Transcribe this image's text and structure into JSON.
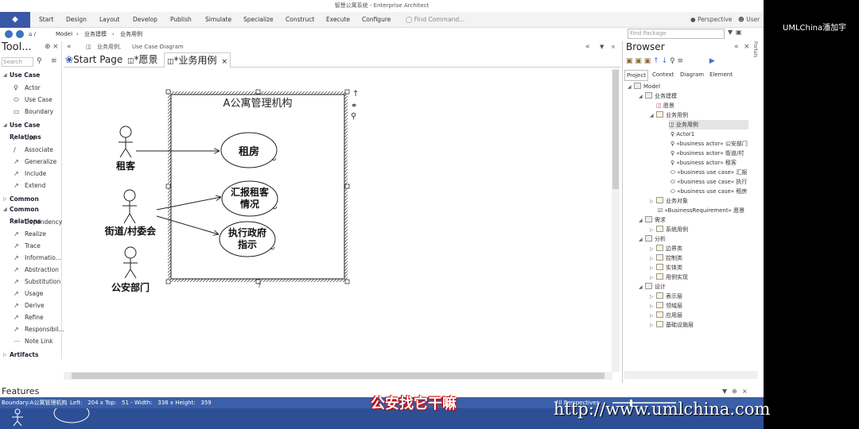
{
  "window": {
    "title": "智慧公寓系统 - Enterprise Architect"
  },
  "ribbon": {
    "menu": [
      "Start",
      "Design",
      "Layout",
      "Develop",
      "Publish",
      "Simulate",
      "Specialize",
      "Construct",
      "Execute",
      "Configure"
    ],
    "find_command": "Find Command...",
    "perspective": "Perspective",
    "user": "User"
  },
  "nav": {
    "path": [
      "Model",
      "业务建模",
      "业务用例"
    ]
  },
  "diagram_header": {
    "name": "业务用例,",
    "type": "Use Case Diagram"
  },
  "toolbox": {
    "title": "Tool...",
    "search_placeholder": "Search",
    "sections": [
      {
        "name": "Use Case",
        "items": [
          "Actor",
          "Use Case",
          "Boundary"
        ]
      },
      {
        "name": "Use Case Relations",
        "items": [
          "Use",
          "Associate",
          "Generalize",
          "Include",
          "Extend"
        ]
      },
      {
        "name": "Common",
        "items": []
      },
      {
        "name": "Common Relations",
        "items": [
          "Dependency",
          "Realize",
          "Trace",
          "Informatio...",
          "Abstraction",
          "Substitution",
          "Usage",
          "Derive",
          "Refine",
          "Responsibil...",
          "Note Link"
        ]
      },
      {
        "name": "Artifacts",
        "items": []
      }
    ]
  },
  "tabs": [
    "Start Page",
    "*愿景",
    "*业务用例"
  ],
  "diagram": {
    "boundary_title": "A公寓管理机构",
    "actors": [
      "租客",
      "街道/村委会",
      "公安部门"
    ],
    "use_cases": [
      "租房",
      "汇报租客情况",
      "执行政府指示"
    ],
    "use_case_lines": [
      [
        "汇报租客",
        "情况"
      ],
      [
        "执行政府",
        "指示"
      ]
    ]
  },
  "browser": {
    "title": "Browser",
    "find_placeholder": "Find Package",
    "tabs": [
      "Project",
      "Context",
      "Diagram",
      "Element"
    ],
    "tree": [
      "Model",
      "业务建模",
      "愿景",
      "业务用例",
      "业务用例",
      "Actor1",
      "«business actor» 公安部门",
      "«business actor» 街道/村",
      "«business actor» 租客",
      "«business use case» 汇报",
      "«business use case» 执行",
      "«business use case» 租房",
      "业务对象",
      "«BusinessRequirement» 愿景",
      "需求",
      "系统用例",
      "分析",
      "边界类",
      "控制类",
      "实体类",
      "用例实现",
      "设计",
      "表示层",
      "领域层",
      "应用层",
      "基础设施层"
    ]
  },
  "features": {
    "label": "Features"
  },
  "statusbar": {
    "element": "Boundary:A公寓管理机构",
    "geometry": "Left:   204 x Top:   51 - Width:   338 x Height:   359",
    "perspectives": "All Perspectives"
  },
  "overlay": {
    "streamer": "UMLChina潘加宇",
    "subtitle": "公安找它干嘛",
    "url": "http://www.umlchina.com"
  }
}
